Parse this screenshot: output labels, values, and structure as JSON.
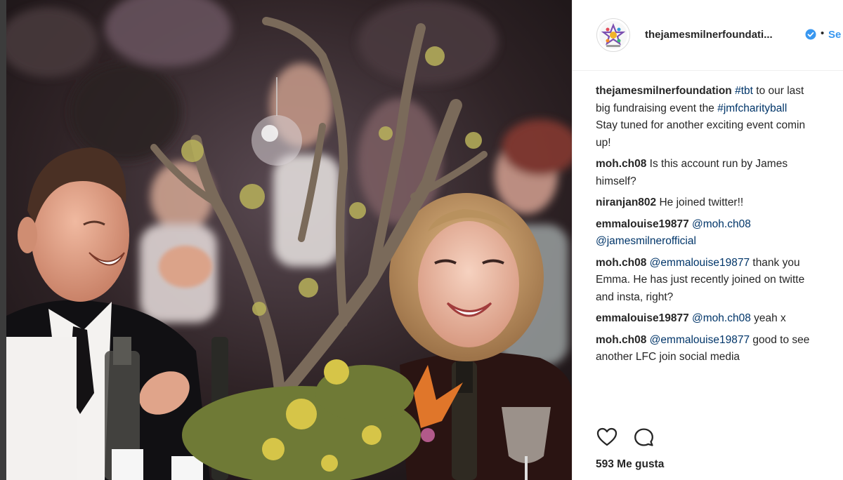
{
  "post": {
    "username": "thejamesmilnerfoundati...",
    "follow_label": "Se",
    "separator": "•"
  },
  "comments": [
    {
      "user": "thejamesmilnerfoundation",
      "lines": [
        [
          " ",
          {
            "link": "#tbt"
          },
          " to our last"
        ],
        [
          "big fundraising event the ",
          {
            "link": "#jmfcharityball"
          }
        ],
        [
          "Stay tuned for another exciting event comin"
        ],
        [
          "up!"
        ]
      ]
    },
    {
      "user": "moh.ch08",
      "lines": [
        [
          " Is this account run by James"
        ],
        [
          "himself?"
        ]
      ]
    },
    {
      "user": "niranjan802",
      "lines": [
        [
          " He joined twitter!!"
        ]
      ]
    },
    {
      "user": "emmalouise19877",
      "lines": [
        [
          " ",
          {
            "link": "@moh.ch08"
          }
        ],
        [
          {
            "link": "@jamesmilnerofficial"
          }
        ]
      ]
    },
    {
      "user": "moh.ch08",
      "lines": [
        [
          " ",
          {
            "link": "@emmalouise19877"
          },
          " thank you"
        ],
        [
          "Emma. He has just recently joined on twitte"
        ],
        [
          "and insta, right?"
        ]
      ]
    },
    {
      "user": "emmalouise19877",
      "lines": [
        [
          " ",
          {
            "link": "@moh.ch08"
          },
          " yeah x"
        ]
      ]
    },
    {
      "user": "moh.ch08",
      "lines": [
        [
          " ",
          {
            "link": "@emmalouise19877"
          },
          " good to see"
        ],
        [
          "another LFC join social media"
        ]
      ]
    }
  ],
  "actions": {
    "like_icon": "heart-outline-icon",
    "comment_icon": "speech-bubble-icon"
  },
  "likes_text": "593 Me gusta",
  "colors": {
    "link": "#003569",
    "follow": "#3897f0",
    "verified": "#3897f0",
    "text": "#262626"
  }
}
